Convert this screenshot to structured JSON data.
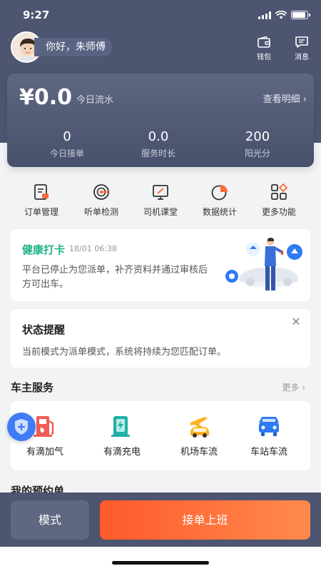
{
  "status_bar": {
    "time": "9:27"
  },
  "header": {
    "greeting": "你好，朱师傅",
    "wallet_label": "钱包",
    "messages_label": "消息"
  },
  "stats": {
    "flow_amount": "¥0.0",
    "flow_label": "今日流水",
    "detail_link": "查看明细",
    "items": [
      {
        "value": "0",
        "label": "今日接单"
      },
      {
        "value": "0.0",
        "label": "服务时长"
      },
      {
        "value": "200",
        "label": "阳光分"
      }
    ]
  },
  "tools": [
    {
      "label": "订单管理",
      "icon": "order-icon"
    },
    {
      "label": "听单检测",
      "icon": "listen-icon"
    },
    {
      "label": "司机课堂",
      "icon": "classroom-icon"
    },
    {
      "label": "数据统计",
      "icon": "chart-icon"
    },
    {
      "label": "更多功能",
      "icon": "more-icon"
    }
  ],
  "health": {
    "title": "健康打卡",
    "time": "18/01 06:38",
    "desc": "平台已停止为您派单，补齐资料并通过审核后方可出车。"
  },
  "notice": {
    "title": "状态提醒",
    "close_glyph": "✕",
    "desc": "当前模式为派单模式，系统将持续为您匹配订单。"
  },
  "owner_services": {
    "title": "车主服务",
    "more": "更多",
    "items": [
      {
        "label": "有滴加气",
        "icon": "gas-station-icon"
      },
      {
        "label": "有滴充电",
        "icon": "charging-icon"
      },
      {
        "label": "机场车流",
        "icon": "airport-icon"
      },
      {
        "label": "车站车流",
        "icon": "station-car-icon"
      }
    ]
  },
  "reservations": {
    "title": "我的预约单"
  },
  "bottom": {
    "mode_label": "模式",
    "go_label": "接单上班"
  },
  "colors": {
    "header_bg": "#4d5571",
    "accent_green": "#1fb389",
    "primary_orange": "#ff5a2c",
    "shield_blue": "#3f7cf5"
  }
}
